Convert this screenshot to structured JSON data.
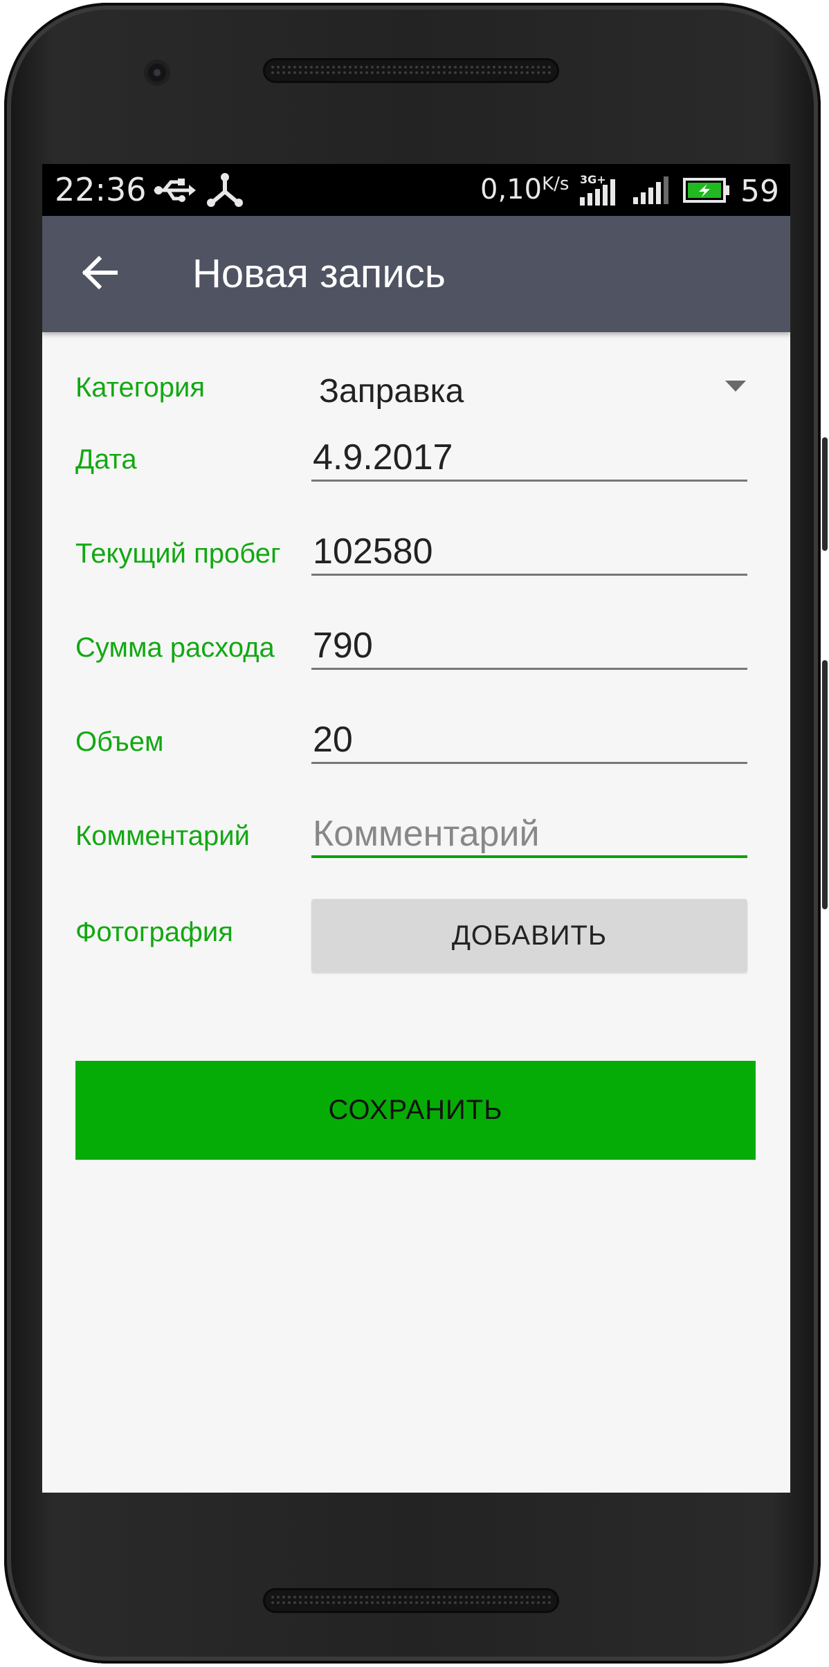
{
  "status_bar": {
    "time": "22:36",
    "net_speed": "0,10",
    "net_speed_unit": "K/s",
    "network_type": "3G+",
    "battery_percent": "59",
    "icons": [
      "usb-icon",
      "share-icon",
      "signal-3g-icon",
      "signal-icon",
      "battery-charging-icon"
    ]
  },
  "app_bar": {
    "back_icon": "arrow-left-icon",
    "title": "Новая запись"
  },
  "form": {
    "category": {
      "label": "Категория",
      "value": "Заправка"
    },
    "date": {
      "label": "Дата",
      "value": "4.9.2017"
    },
    "mileage": {
      "label": "Текущий пробег",
      "value": "102580"
    },
    "expense": {
      "label": "Сумма расхода",
      "value": "790"
    },
    "volume": {
      "label": "Объем",
      "value": "20"
    },
    "comment": {
      "label": "Комментарий",
      "value": "",
      "placeholder": "Комментарий"
    },
    "photo": {
      "label": "Фотография",
      "button": "ДОБАВИТЬ"
    }
  },
  "save_button": "СОХРАНИТЬ",
  "colors": {
    "accent": "#06ac06",
    "label": "#12a812",
    "app_bar": "#4f5362",
    "screen_bg": "#f6f6f6",
    "button_gray": "#d8d8d8"
  }
}
